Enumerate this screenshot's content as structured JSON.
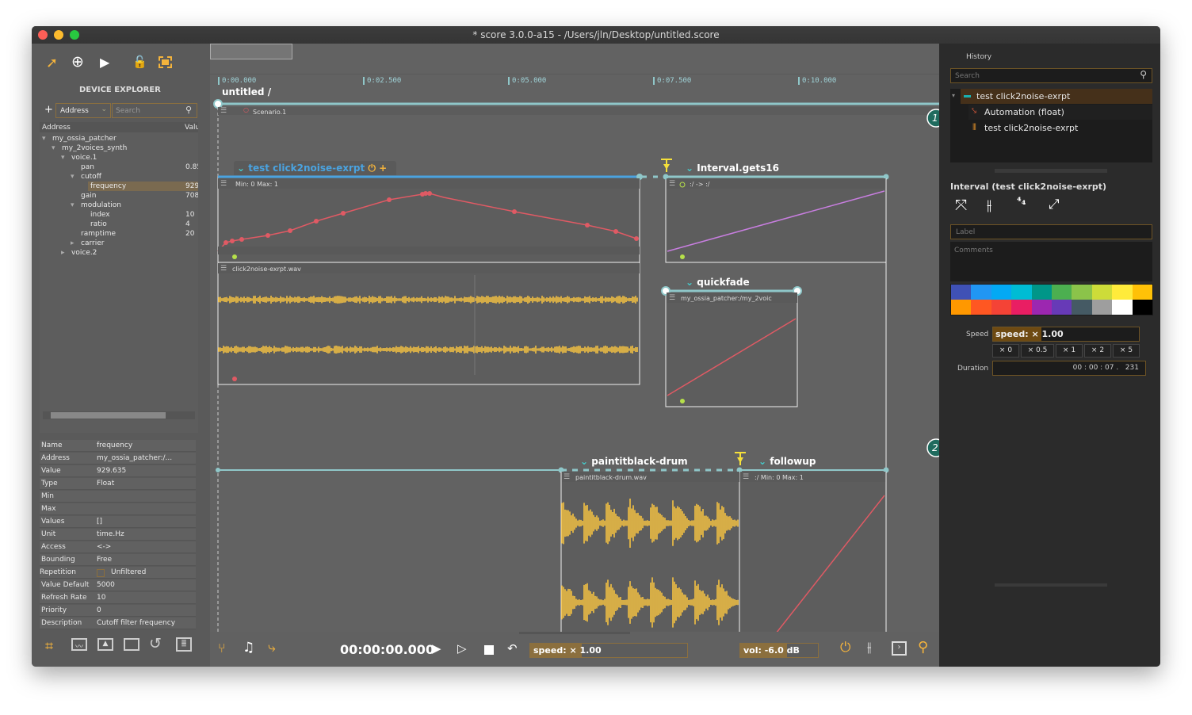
{
  "window": {
    "title": "* score 3.0.0-a15 - /Users/jln/Desktop/untitled.score"
  },
  "left": {
    "heading": "DEVICE EXPLORER",
    "add_label": "+",
    "filter_select": "Address",
    "search_placeholder": "Search",
    "columns": [
      "Address",
      "Value"
    ],
    "tree": [
      {
        "label": "my_ossia_patcher",
        "value": ""
      },
      {
        "label": "my_2voices_synth",
        "value": ""
      },
      {
        "label": "voice.1",
        "value": ""
      },
      {
        "label": "pan",
        "value": "0.85"
      },
      {
        "label": "cutoff",
        "value": ""
      },
      {
        "label": "frequency",
        "value": "929"
      },
      {
        "label": "gain",
        "value": "708"
      },
      {
        "label": "modulation",
        "value": ""
      },
      {
        "label": "index",
        "value": "10"
      },
      {
        "label": "ratio",
        "value": "4"
      },
      {
        "label": "ramptime",
        "value": "20"
      },
      {
        "label": "carrier",
        "value": ""
      },
      {
        "label": "voice.2",
        "value": ""
      }
    ],
    "properties": [
      [
        "Name",
        "frequency"
      ],
      [
        "Address",
        "my_ossia_patcher:/..."
      ],
      [
        "Value",
        "929.635"
      ],
      [
        "Type",
        "Float"
      ],
      [
        "Min",
        ""
      ],
      [
        "Max",
        ""
      ],
      [
        "Values",
        "[]"
      ],
      [
        "Unit",
        "time.Hz"
      ],
      [
        "Access",
        "<->"
      ],
      [
        "Bounding",
        "Free"
      ],
      [
        "Repetition",
        "Unfiltered"
      ],
      [
        "Value Default",
        "5000"
      ],
      [
        "Refresh Rate",
        "10"
      ],
      [
        "Priority",
        "0"
      ],
      [
        "Description",
        "Cutoff filter frequency"
      ]
    ]
  },
  "timeline": {
    "ticks": [
      "0:00.000",
      "0:02.500",
      "0:05.000",
      "0:07.500",
      "0:10.000"
    ]
  },
  "scenario": {
    "breadcrumb": "untitled /",
    "name": "Scenario.1",
    "intervals": {
      "i1": {
        "title": "test click2noise-exrpt",
        "auto_label": "Min: 0  Max: 1",
        "sound_label": "click2noise-exrpt.wav"
      },
      "i2": {
        "title": "Interval.gets16",
        "label": ":/ -> :/"
      },
      "i3": {
        "title": "quickfade",
        "label": "my_ossia_patcher:/my_2voic"
      },
      "i4": {
        "title": "paintitblack-drum",
        "label": "paintitblack-drum.wav"
      },
      "i5": {
        "title": "followup",
        "label": ":/  Min: 0  Max: 1"
      }
    },
    "markers": [
      "1",
      "2"
    ]
  },
  "transport": {
    "time": "00:00:00.000",
    "speed": "speed: × 1.00",
    "speed_fraction": 0.33,
    "volume": "vol: -6.0 dB",
    "volume_fraction": 0.6
  },
  "right": {
    "history_label": "History",
    "search_placeholder": "Search",
    "history": [
      "test click2noise-exrpt",
      "Automation (float)",
      "test click2noise-exrpt"
    ],
    "inspector_title": "Interval (test click2noise-exrpt)",
    "label_placeholder": "Label",
    "comments_placeholder": "Comments",
    "palette": [
      "#3f51b5",
      "#2196f3",
      "#03a9f4",
      "#00bcd4",
      "#009688",
      "#4caf50",
      "#8bc34a",
      "#cddc39",
      "#ffeb3b",
      "#ffc107",
      "#ff9800",
      "#ff5722",
      "#f44336",
      "#e91e63",
      "#9c27b0",
      "#673ab7",
      "#455a64",
      "#9e9e9e",
      "#ffffff",
      "#000000"
    ],
    "speed_label": "Speed",
    "speed_value": "speed: × 1.00",
    "speed_presets": [
      "× 0",
      "× 0.5",
      "× 1",
      "× 2",
      "× 5"
    ],
    "duration_label": "Duration",
    "duration_value": "00 : 00 : 07 .   231"
  },
  "colors": {
    "accent": "#f5b43c",
    "interval": "#8fc7c9",
    "selected": "#4aa3e0",
    "automation": "#e05a64",
    "audio": "#f5c242"
  }
}
